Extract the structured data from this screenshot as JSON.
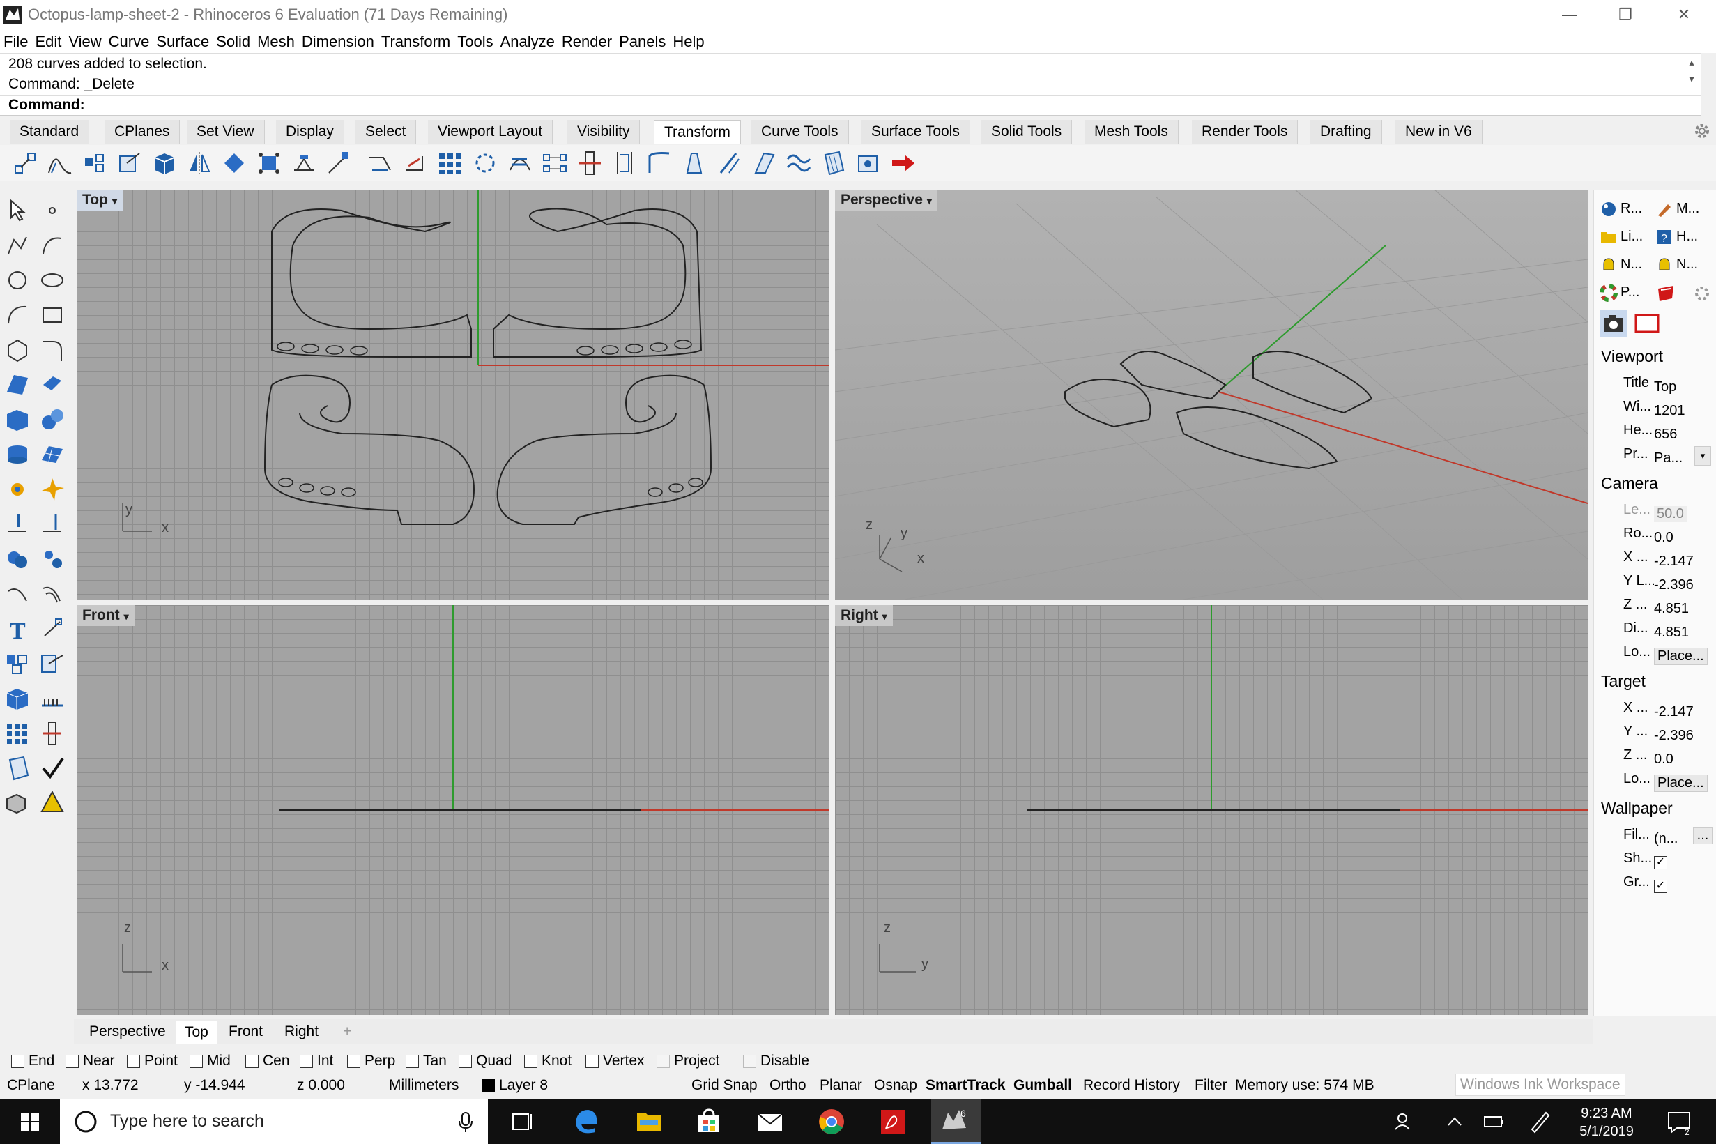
{
  "window": {
    "title": "Octopus-lamp-sheet-2 - Rhinoceros 6 Evaluation (71 Days Remaining)",
    "controls": {
      "minimize": "—",
      "restore": "❐",
      "close": "✕"
    }
  },
  "menu": [
    "File",
    "Edit",
    "View",
    "Curve",
    "Surface",
    "Solid",
    "Mesh",
    "Dimension",
    "Transform",
    "Tools",
    "Analyze",
    "Render",
    "Panels",
    "Help"
  ],
  "command_history": [
    "208 curves added to selection.",
    "Command: _Delete"
  ],
  "command_prompt": "Command:",
  "toolbar_tabs": [
    "Standard",
    "CPlanes",
    "Set View",
    "Display",
    "Select",
    "Viewport Layout",
    "Visibility",
    "Transform",
    "Curve Tools",
    "Surface Tools",
    "Solid Tools",
    "Mesh Tools",
    "Render Tools",
    "Drafting",
    "New in V6"
  ],
  "active_toolbar_tab": "Transform",
  "viewports": {
    "top": {
      "label": "Top",
      "axis_x": "x",
      "axis_y": "y"
    },
    "perspective": {
      "label": "Perspective",
      "axis_x": "x",
      "axis_y": "y",
      "axis_z": "z"
    },
    "front": {
      "label": "Front",
      "axis_x": "x",
      "axis_y": "z"
    },
    "right": {
      "label": "Right",
      "axis_x": "y",
      "axis_y": "z"
    }
  },
  "viewport_tabs": [
    "Perspective",
    "Top",
    "Front",
    "Right"
  ],
  "active_viewport_tab": "Top",
  "add_tab_icon": "+",
  "right_panel": {
    "tabs": [
      {
        "icon": "rendering-icon",
        "label": "R..."
      },
      {
        "icon": "materials-icon",
        "label": "M..."
      },
      {
        "icon": "libraries-icon",
        "label": "Li..."
      },
      {
        "icon": "help-icon",
        "label": "H..."
      },
      {
        "icon": "notes-icon",
        "label": "N..."
      },
      {
        "icon": "named-views-icon",
        "label": "N..."
      },
      {
        "icon": "properties-icon",
        "label": "P..."
      }
    ],
    "viewport_section": "Viewport",
    "viewport_rows": [
      {
        "key": "Title",
        "value": "Top"
      },
      {
        "key": "Wi...",
        "value": "1201"
      },
      {
        "key": "He...",
        "value": "656"
      },
      {
        "key": "Pr...",
        "value": "Pa..."
      }
    ],
    "camera_section": "Camera",
    "camera_rows": [
      {
        "key": "Le...",
        "value": "50.0"
      },
      {
        "key": "Ro...",
        "value": "0.0"
      },
      {
        "key": "X ...",
        "value": "-2.147"
      },
      {
        "key": "Y L...",
        "value": "-2.396"
      },
      {
        "key": "Z ...",
        "value": "4.851"
      },
      {
        "key": "Di...",
        "value": "4.851"
      },
      {
        "key": "Lo...",
        "value": "Place..."
      }
    ],
    "target_section": "Target",
    "target_rows": [
      {
        "key": "X ...",
        "value": "-2.147"
      },
      {
        "key": "Y ...",
        "value": "-2.396"
      },
      {
        "key": "Z ...",
        "value": "0.0"
      },
      {
        "key": "Lo...",
        "value": "Place..."
      }
    ],
    "wallpaper_section": "Wallpaper",
    "wallpaper_rows": [
      {
        "key": "Fil...",
        "value": "(n..."
      },
      {
        "key": "Sh...",
        "value": "checked"
      },
      {
        "key": "Gr...",
        "value": "checked"
      }
    ],
    "browse_button": "..."
  },
  "osnaps": [
    "End",
    "Near",
    "Point",
    "Mid",
    "Cen",
    "Int",
    "Perp",
    "Tan",
    "Quad",
    "Knot",
    "Vertex",
    "Project",
    "Disable"
  ],
  "status": {
    "cplane": "CPlane",
    "x": "x 13.772",
    "y": "y -14.944",
    "z": "z 0.000",
    "units": "Millimeters",
    "layer": "Layer 8",
    "toggles": [
      "Grid Snap",
      "Ortho",
      "Planar",
      "Osnap",
      "SmartTrack",
      "Gumball",
      "Record History",
      "Filter"
    ],
    "memory": "Memory use: 574 MB",
    "ink_tooltip": "Windows Ink Workspace"
  },
  "taskbar": {
    "search_placeholder": "Type here to search",
    "time": "9:23 AM",
    "date": "5/1/2019"
  },
  "colors": {
    "x_axis": "#c0392b",
    "y_axis": "#2e9b2e",
    "viewport_bg": "#a3a3a3",
    "curves": "#222222"
  }
}
